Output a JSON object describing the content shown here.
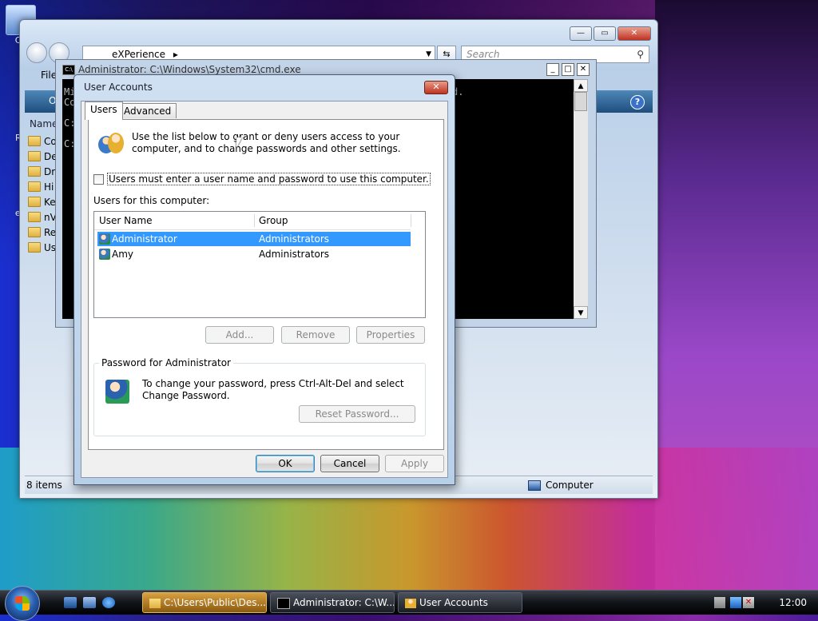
{
  "desktop": {
    "icons": [
      {
        "label": "Co",
        "name": "computer"
      },
      {
        "label": "Re",
        "name": "recycle-bin"
      },
      {
        "label": "eX",
        "name": "experience"
      }
    ]
  },
  "explorer": {
    "address": "eXPerience",
    "search_placeholder": "Search",
    "menu_file": "File",
    "cmdbar_label": "O",
    "column_name": "Name",
    "files": [
      "Co",
      "De",
      "Dr",
      "Hi",
      "Ke",
      "nV",
      "Re",
      "Us"
    ],
    "status_items": "8 items",
    "status_zone": "Computer"
  },
  "cmd": {
    "title": "Administrator: C:\\Windows\\System32\\cmd.exe",
    "lines": [
      "Mi",
      "Co",
      "",
      "C:",
      "",
      "C:"
    ],
    "line_suffix": "d."
  },
  "dialog": {
    "title": "User Accounts",
    "tabs": [
      "Users",
      "Advanced"
    ],
    "intro": "Use the list below to grant or deny users access to your computer, and to change passwords and other settings.",
    "checkbox_label": "Users must enter a user name and password to use this computer.",
    "checkbox_checked": false,
    "users_label": "Users for this computer:",
    "columns": [
      "User Name",
      "Group"
    ],
    "users": [
      {
        "name": "Administrator",
        "group": "Administrators",
        "selected": true
      },
      {
        "name": "Amy",
        "group": "Administrators",
        "selected": false
      }
    ],
    "buttons": {
      "add": "Add...",
      "remove": "Remove",
      "properties": "Properties"
    },
    "password_group_title": "Password for Administrator",
    "password_text": "To change your password, press Ctrl-Alt-Del and select Change Password.",
    "reset_button": "Reset Password...",
    "ok": "OK",
    "cancel": "Cancel",
    "apply": "Apply"
  },
  "taskbar": {
    "tasks": [
      {
        "label": "C:\\Users\\Public\\Des...",
        "active": true
      },
      {
        "label": "Administrator: C:\\W...",
        "active": false
      },
      {
        "label": "User Accounts",
        "active": false
      }
    ],
    "clock": "12:00"
  }
}
